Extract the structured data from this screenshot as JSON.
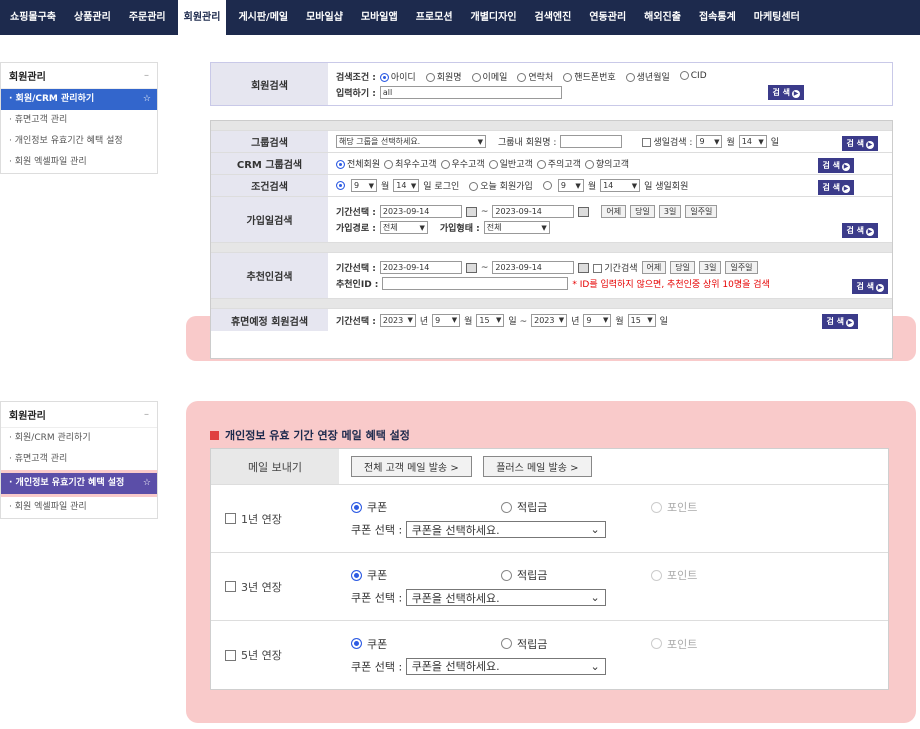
{
  "nav": [
    "쇼핑몰구축",
    "상품관리",
    "주문관리",
    "회원관리",
    "게시판/메일",
    "모바일샵",
    "모바일앱",
    "프로모션",
    "개별디자인",
    "검색엔진",
    "연동관리",
    "해외진출",
    "접속통계",
    "마케팅센터"
  ],
  "sidebar1": {
    "title": "회원관리",
    "minus": "–",
    "items": [
      "· 회원/CRM 관리하기",
      "· 휴면고객 관리",
      "· 개인정보 유효기간 혜택 설정",
      "· 회원 엑셀파일 관리"
    ],
    "star": "☆"
  },
  "sidebar2": {
    "title": "회원관리",
    "minus": "–",
    "items": [
      "· 회원/CRM 관리하기",
      "· 휴면고객 관리",
      "· 개인정보 유효기간 혜택 설정",
      "· 회원 엑셀파일 관리"
    ],
    "star": "☆"
  },
  "search_btn": "검 색",
  "member_search": {
    "label": "회원검색",
    "cond_label": "검색조건 :",
    "options": [
      "아이디",
      "회원명",
      "이메일",
      "연락처",
      "핸드폰번호",
      "생년월일",
      "CID"
    ],
    "input_label": "입력하기 :",
    "input_value": "all"
  },
  "group_search": {
    "label": "그룹검색",
    "select": "해당 그룹을 선택하세요.",
    "member_label": "그룹내 회원명 :",
    "birth_label": "생일검색 :",
    "month": "9",
    "month_unit": "월",
    "day": "14",
    "day_unit": "일"
  },
  "crm_search": {
    "label": "CRM 그룹검색",
    "options": [
      "전체회원",
      "최우수고객",
      "우수고객",
      "일반고객",
      "주의고객",
      "향의고객"
    ]
  },
  "cond_search": {
    "label": "조건검색",
    "m": "9",
    "mu": "월",
    "d": "14",
    "du": "일 로그인",
    "opt2": "오늘 회원가입",
    "m2": "9",
    "mu2": "월",
    "d2": "14",
    "du2": "일 생일회원"
  },
  "join_search": {
    "label": "가입일검색",
    "period_label": "기간선택 :",
    "from": "2023-09-14",
    "tilde": "~",
    "to": "2023-09-14",
    "quick": [
      "어제",
      "당일",
      "3일",
      "일주일"
    ],
    "path_label": "가입경로 :",
    "path": "전체",
    "type_label": "가입형태 :",
    "type": "전체"
  },
  "rec_search": {
    "label": "추천인검색",
    "period_label": "기간선택 :",
    "from": "2023-09-14",
    "tilde": "~",
    "to": "2023-09-14",
    "check_label": "기간검색",
    "quick": [
      "어제",
      "당일",
      "3일",
      "일주일"
    ],
    "id_label": "추천인ID :",
    "notice": "* ID를 입력하지 않으면, 추천인중 상위 10명을 검색"
  },
  "dormant": {
    "label": "휴면예정 회원검색",
    "period_label": "기간선택 :",
    "y1": "2023",
    "yu": "년",
    "m1": "9",
    "mu": "월",
    "d1": "15",
    "du": "일 ~",
    "y2": "2023",
    "m2": "9",
    "d2": "15",
    "du2": "일"
  },
  "section": {
    "title": "개인정보 유효 기간 연장 메일 혜택 설정",
    "mail_label": "메일 보내기",
    "mail_btn1": "전체 고객 메일 발송 >",
    "mail_btn2": "플러스 메일 발송 >",
    "rows": [
      {
        "label": "1년 연장"
      },
      {
        "label": "3년 연장"
      },
      {
        "label": "5년 연장"
      }
    ],
    "opt_coupon": "쿠폰",
    "opt_point_save": "적립금",
    "opt_point": "포인트",
    "coupon_label": "쿠폰 선택 :",
    "coupon_select": "쿠폰을 선택하세요."
  }
}
